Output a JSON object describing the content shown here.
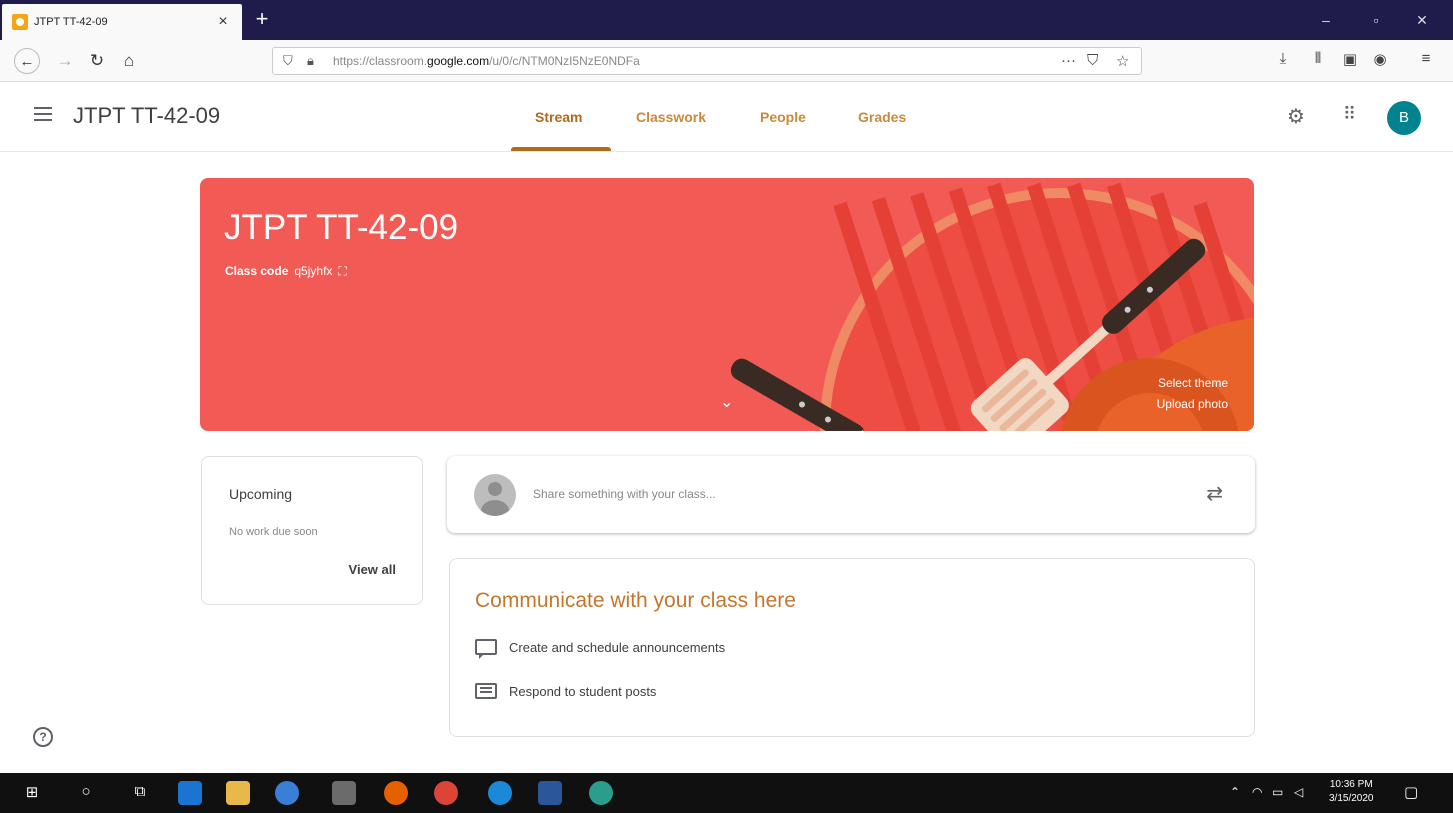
{
  "browser": {
    "tab_title": "JTPT TT-42-09",
    "tab_close": "×",
    "new_tab": "+",
    "url_prefix": "https://classroom.",
    "url_domain": "google.com",
    "url_suffix": "/u/0/c/NTM0NzI5NzE0NDFa",
    "win_min": "–",
    "win_max": "▫",
    "win_close": "✕"
  },
  "header": {
    "course_title": "JTPT TT-42-09",
    "tabs": [
      {
        "label": "Stream"
      },
      {
        "label": "Classwork"
      },
      {
        "label": "People"
      },
      {
        "label": "Grades"
      }
    ],
    "avatar_letter": "B"
  },
  "banner": {
    "title": "JTPT TT-42-09",
    "class_code_label": "Class code",
    "class_code": "q5jyhfx",
    "select_theme": "Select theme",
    "upload_photo": "Upload photo"
  },
  "upcoming": {
    "title": "Upcoming",
    "empty_text": "No work due soon",
    "view_all": "View all"
  },
  "share": {
    "placeholder": "Share something with your class..."
  },
  "communicate": {
    "title": "Communicate with your class here",
    "items": [
      {
        "label": "Create and schedule announcements"
      },
      {
        "label": "Respond to student posts"
      }
    ]
  },
  "help_label": "?",
  "taskbar": {
    "time": "10:36 PM",
    "date": "3/15/2020"
  },
  "colors": {
    "banner": "#f25b55",
    "accent": "#b06a1e",
    "avatar": "#00838f",
    "browser_tabbar": "#1f1b4a"
  }
}
